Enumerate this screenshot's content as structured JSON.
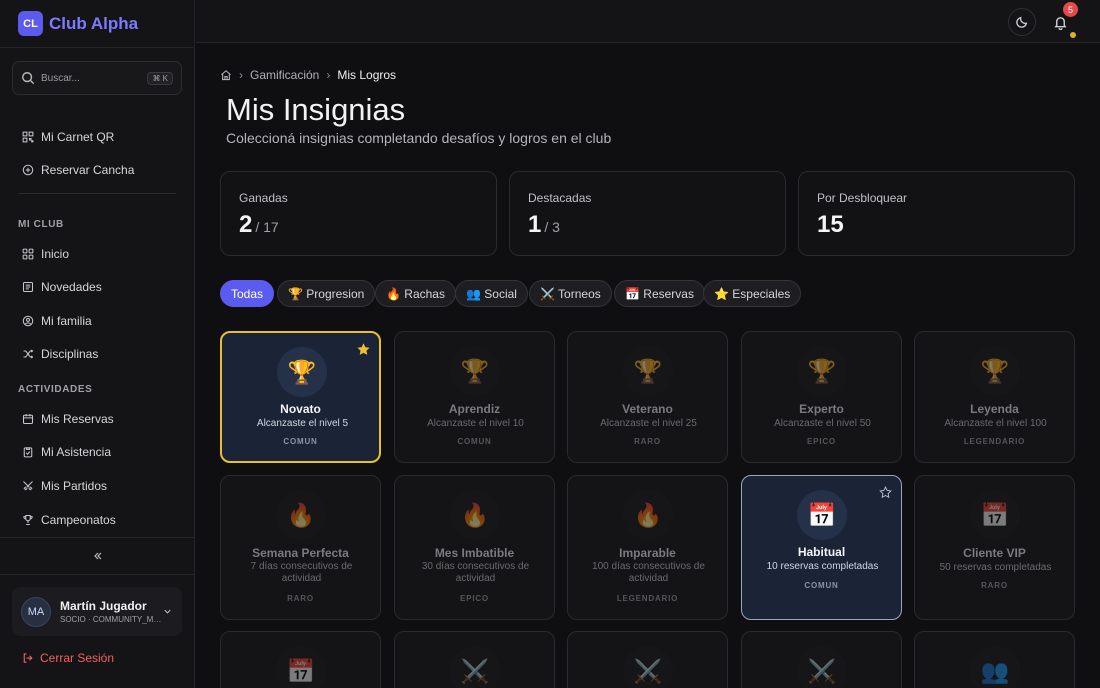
{
  "brand": {
    "logo": "CL",
    "name": "Club Alpha"
  },
  "search": {
    "placeholder": "Buscar...",
    "shortcut": "⌘ K"
  },
  "quick_links": [
    {
      "label": "Mi Carnet QR",
      "icon": "qr-code-icon"
    },
    {
      "label": "Reservar Cancha",
      "icon": "plus-circle-icon"
    }
  ],
  "sections": [
    {
      "title": "MI CLUB",
      "items": [
        {
          "label": "Inicio",
          "icon": "grid-icon"
        },
        {
          "label": "Novedades",
          "icon": "newspaper-icon"
        },
        {
          "label": "Mi familia",
          "icon": "users-icon"
        },
        {
          "label": "Disciplinas",
          "icon": "shuffle-icon"
        }
      ]
    },
    {
      "title": "ACTIVIDADES",
      "items": [
        {
          "label": "Mis Reservas",
          "icon": "calendar-icon"
        },
        {
          "label": "Mi Asistencia",
          "icon": "clipboard-check-icon"
        },
        {
          "label": "Mis Partidos",
          "icon": "swords-icon"
        },
        {
          "label": "Campeonatos",
          "icon": "trophy-icon"
        }
      ]
    }
  ],
  "user": {
    "initials": "MA",
    "name": "Martín Jugador",
    "role": "SOCIO · COMMUNITY_MEMBER"
  },
  "logout_label": "Cerrar Sesión",
  "topbar": {
    "notification_count": "5"
  },
  "breadcrumb": {
    "section": "Gamificación",
    "current": "Mis Logros"
  },
  "page": {
    "title": "Mis Insignias",
    "subtitle": "Coleccioná insignias completando desafíos y logros en el club"
  },
  "stats": [
    {
      "label": "Ganadas",
      "value": "2",
      "total": "/ 17"
    },
    {
      "label": "Destacadas",
      "value": "1",
      "total": "/ 3"
    },
    {
      "label": "Por Desbloquear",
      "value": "15",
      "total": ""
    }
  ],
  "filters": [
    {
      "label": "Todas",
      "active": true
    },
    {
      "label": "🏆 Progresion",
      "active": false
    },
    {
      "label": "🔥 Rachas",
      "active": false
    },
    {
      "label": "👥 Social",
      "active": false
    },
    {
      "label": "⚔️ Torneos",
      "active": false
    },
    {
      "label": "📅 Reservas",
      "active": false
    },
    {
      "label": "⭐ Especiales",
      "active": false
    }
  ],
  "badges": [
    {
      "emoji": "🏆",
      "name": "Novato",
      "desc": "Alcanzaste el nivel 5",
      "rarity": "COMUN",
      "state": "earned",
      "featured": true
    },
    {
      "emoji": "🏆",
      "name": "Aprendiz",
      "desc": "Alcanzaste el nivel 10",
      "rarity": "COMUN",
      "state": "locked"
    },
    {
      "emoji": "🏆",
      "name": "Veterano",
      "desc": "Alcanzaste el nivel 25",
      "rarity": "RARO",
      "state": "locked"
    },
    {
      "emoji": "🏆",
      "name": "Experto",
      "desc": "Alcanzaste el nivel 50",
      "rarity": "EPICO",
      "state": "locked"
    },
    {
      "emoji": "🏆",
      "name": "Leyenda",
      "desc": "Alcanzaste el nivel 100",
      "rarity": "LEGENDARIO",
      "state": "locked"
    },
    {
      "emoji": "🔥",
      "name": "Semana Perfecta",
      "desc": "7 días consecutivos de actividad",
      "rarity": "RARO",
      "state": "locked"
    },
    {
      "emoji": "🔥",
      "name": "Mes Imbatible",
      "desc": "30 días consecutivos de actividad",
      "rarity": "EPICO",
      "state": "locked"
    },
    {
      "emoji": "🔥",
      "name": "Imparable",
      "desc": "100 días consecutivos de actividad",
      "rarity": "LEGENDARIO",
      "state": "locked"
    },
    {
      "emoji": "📅",
      "name": "Habitual",
      "desc": "10 reservas completadas",
      "rarity": "COMUN",
      "state": "earned2",
      "featured": false
    },
    {
      "emoji": "📅",
      "name": "Cliente VIP",
      "desc": "50 reservas completadas",
      "rarity": "RARO",
      "state": "locked"
    },
    {
      "emoji": "📅"
    },
    {
      "emoji": "⚔️"
    },
    {
      "emoji": "⚔️"
    },
    {
      "emoji": "⚔️"
    },
    {
      "emoji": "👥"
    }
  ],
  "colors": {
    "accent": "#5b5bf0",
    "featured_border": "#e7c030",
    "logout": "#f06060"
  }
}
